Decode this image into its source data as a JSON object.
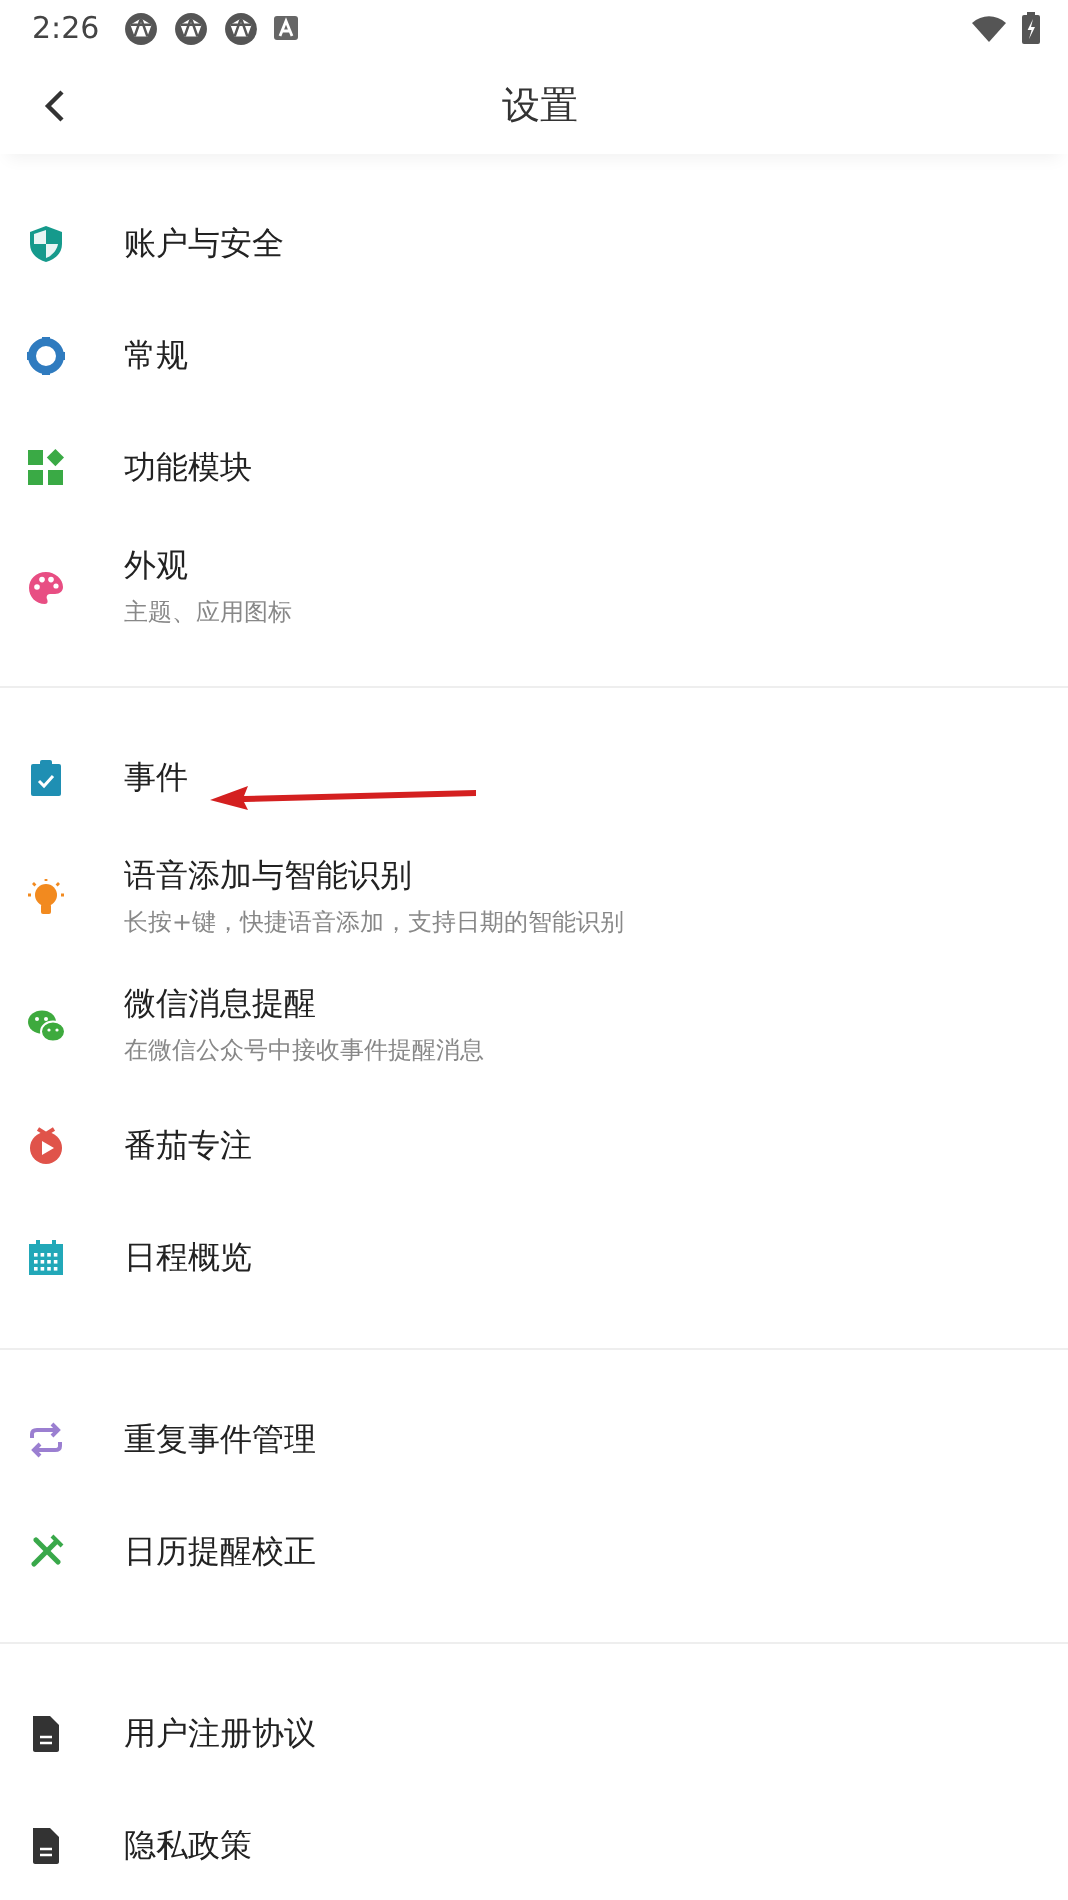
{
  "status_bar": {
    "time": "2:26"
  },
  "header": {
    "title": "设置"
  },
  "sections": [
    {
      "items": [
        {
          "kind": "shield",
          "title": "账户与安全"
        },
        {
          "kind": "gear",
          "title": "常规"
        },
        {
          "kind": "modules",
          "title": "功能模块"
        },
        {
          "kind": "palette",
          "title": "外观",
          "subtitle": "主题、应用图标"
        }
      ]
    },
    {
      "items": [
        {
          "kind": "clipboard",
          "title": "事件"
        },
        {
          "kind": "bulb",
          "title": "语音添加与智能识别",
          "subtitle": "长按+键，快捷语音添加，支持日期的智能识别"
        },
        {
          "kind": "chat",
          "title": "微信消息提醒",
          "subtitle": "在微信公众号中接收事件提醒消息"
        },
        {
          "kind": "timer",
          "title": "番茄专注"
        },
        {
          "kind": "calendar",
          "title": "日程概览"
        }
      ]
    },
    {
      "items": [
        {
          "kind": "repeat",
          "title": "重复事件管理"
        },
        {
          "kind": "tools",
          "title": "日历提醒校正"
        }
      ]
    },
    {
      "items": [
        {
          "kind": "document",
          "title": "用户注册协议"
        },
        {
          "kind": "document",
          "title": "隐私政策"
        }
      ]
    }
  ]
}
